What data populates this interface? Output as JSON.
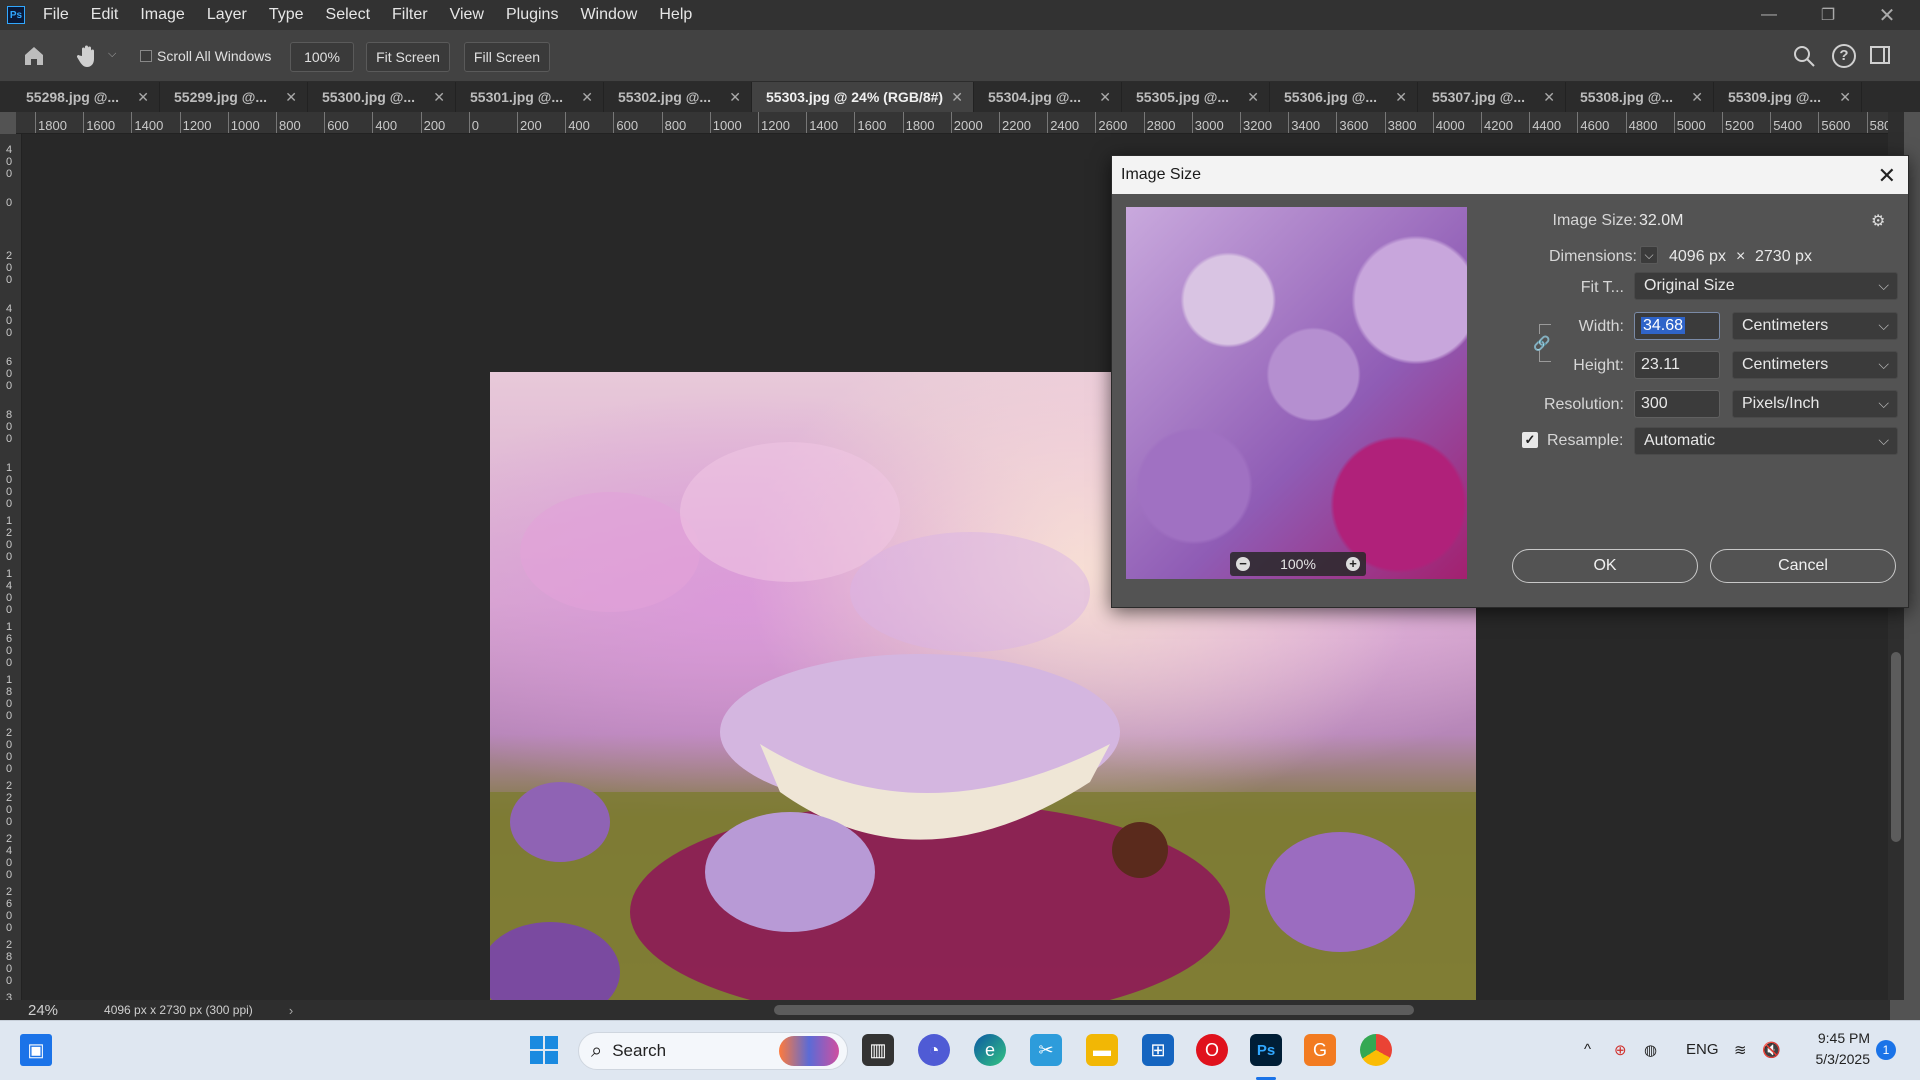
{
  "app": {
    "logo": "Ps"
  },
  "menu": [
    "File",
    "Edit",
    "Image",
    "Layer",
    "Type",
    "Select",
    "Filter",
    "View",
    "Plugins",
    "Window",
    "Help"
  ],
  "options": {
    "scroll_all_windows": "Scroll All Windows",
    "zoom": "100%",
    "fit_screen": "Fit Screen",
    "fill_screen": "Fill Screen"
  },
  "tabs": [
    {
      "label": "55298.jpg @..."
    },
    {
      "label": "55299.jpg @..."
    },
    {
      "label": "55300.jpg @..."
    },
    {
      "label": "55301.jpg @..."
    },
    {
      "label": "55302.jpg @..."
    },
    {
      "label": "55303.jpg @ 24% (RGB/8#)",
      "active": true
    },
    {
      "label": "55304.jpg @..."
    },
    {
      "label": "55305.jpg @..."
    },
    {
      "label": "55306.jpg @..."
    },
    {
      "label": "55307.jpg @..."
    },
    {
      "label": "55308.jpg @..."
    },
    {
      "label": "55309.jpg @..."
    }
  ],
  "ruler_top": [
    "1800",
    "1600",
    "1400",
    "1200",
    "1000",
    "800",
    "600",
    "400",
    "200",
    "0",
    "200",
    "400",
    "600",
    "800",
    "1000",
    "1200",
    "1400",
    "1600",
    "1800",
    "2000",
    "2200",
    "2400",
    "2600",
    "2800",
    "3000",
    "3200",
    "3400",
    "3600",
    "3800",
    "4000",
    "4200",
    "4400",
    "4600",
    "4800",
    "5000",
    "5200",
    "5400",
    "5600",
    "580"
  ],
  "ruler_left": [
    "400",
    "0",
    "200",
    "400",
    "600",
    "800",
    "1000",
    "1200",
    "1400",
    "1600",
    "1800",
    "2000",
    "2200",
    "2400",
    "2600",
    "2800",
    "3"
  ],
  "status": {
    "zoom": "24%",
    "doc_info": "4096 px x 2730 px (300 ppi)"
  },
  "dialog": {
    "title": "Image Size",
    "image_size_label": "Image Size:",
    "image_size_value": "32.0M",
    "dimensions_label": "Dimensions:",
    "dim_width": "4096 px",
    "dim_x": "×",
    "dim_height": "2730 px",
    "fit_label": "Fit T...",
    "fit_value": "Original Size",
    "width_label": "Width:",
    "width_value": "34.68",
    "width_unit": "Centimeters",
    "height_label": "Height:",
    "height_value": "23.11",
    "height_unit": "Centimeters",
    "resolution_label": "Resolution:",
    "resolution_value": "300",
    "resolution_unit": "Pixels/Inch",
    "resample_label": "Resample:",
    "resample_value": "Automatic",
    "resample_checked": true,
    "preview_zoom": "100%",
    "ok": "OK",
    "cancel": "Cancel"
  },
  "taskbar": {
    "search": "Search",
    "lang": "ENG",
    "time": "9:45 PM",
    "date": "5/3/2025",
    "notification_count": "1"
  }
}
